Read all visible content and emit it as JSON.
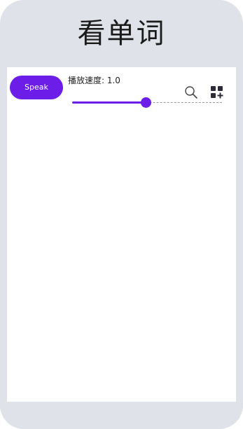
{
  "header": {
    "title": "看单词"
  },
  "controls": {
    "speak_label": "Speak",
    "speed_label": "播放速度: 1.0",
    "speed_slider": {
      "value": 1.0,
      "fill_fraction": 0.49
    }
  },
  "icons": {
    "search": "search-icon",
    "grid": "grid-add-icon"
  },
  "colors": {
    "accent": "#6c1ee8",
    "frame": "#dfe2e8",
    "content_bg": "#ffffff"
  }
}
